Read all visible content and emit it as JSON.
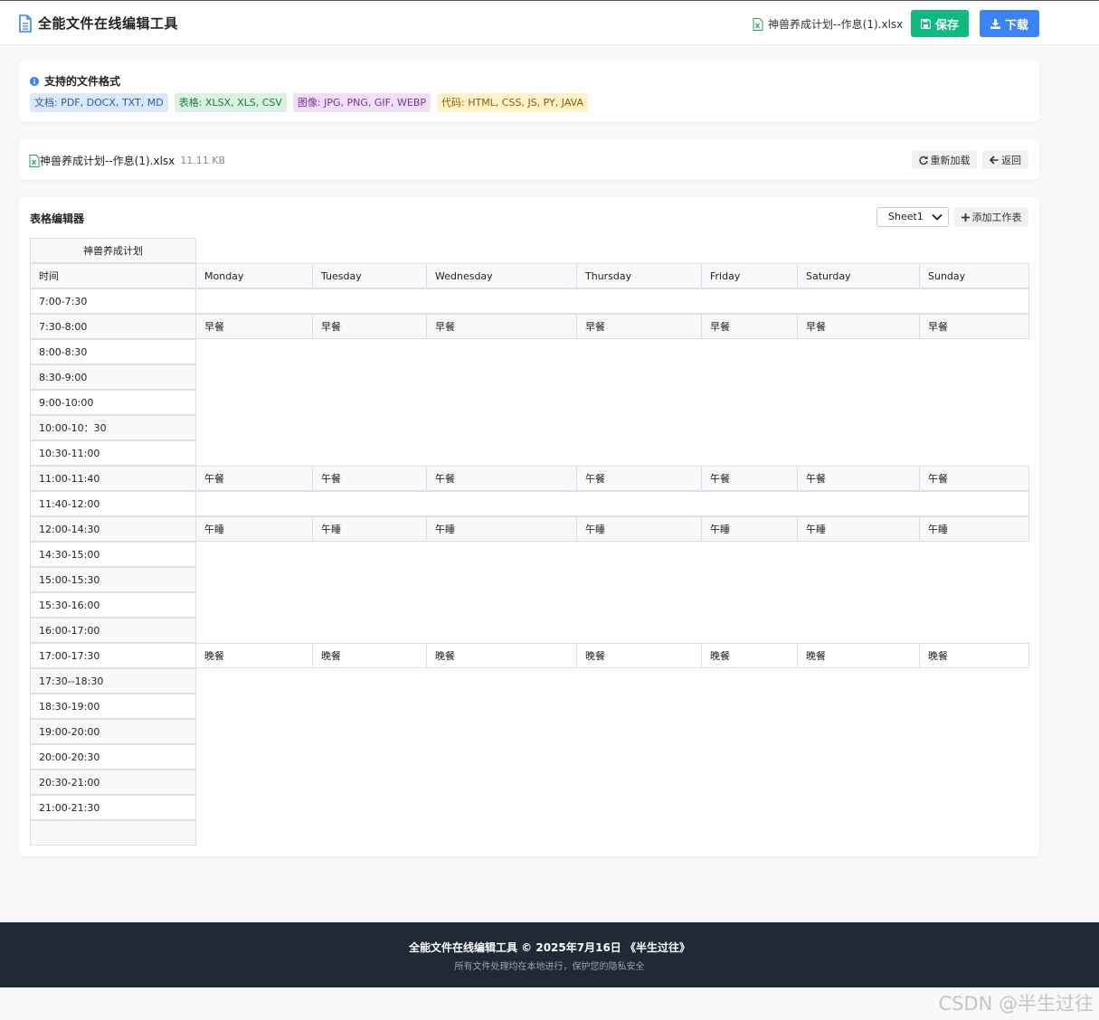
{
  "app": {
    "title": "全能文件在线编辑工具",
    "current_file": "神兽养成计划--作息(1).xlsx",
    "save_label": "保存",
    "download_label": "下载"
  },
  "formats": {
    "heading": "支持的文件格式",
    "tags": [
      {
        "label": "文档: PDF, DOCX, TXT, MD",
        "color": "#dbe8fb"
      },
      {
        "label": "表格: XLSX, XLS, CSV",
        "color": "#daf2e1"
      },
      {
        "label": "图像: JPG, PNG, GIF, WEBP",
        "color": "#efe0f8"
      },
      {
        "label": "代码: HTML, CSS, JS, PY, JAVA",
        "color": "#fdf3c7"
      }
    ]
  },
  "file": {
    "name": "神兽养成计划--作息(1).xlsx",
    "size": "11.11 KB",
    "reload_label": "重新加载",
    "back_label": "返回"
  },
  "editor": {
    "title": "表格编辑器",
    "sheet": "Sheet1",
    "add_sheet_label": "添加工作表",
    "table_title": "神兽养成计划",
    "header": [
      "时间",
      "Monday",
      "Tuesday",
      "Wednesday",
      "Thursday",
      "Friday",
      "Saturday",
      "Sunday"
    ],
    "rows": [
      [
        "7:00-7:30",
        "",
        "",
        "",
        "",
        "",
        "",
        ""
      ],
      [
        "7:30-8:00",
        "早餐",
        "早餐",
        "早餐",
        "早餐",
        "早餐",
        "早餐",
        "早餐"
      ],
      [
        "8:00-8:30",
        "",
        "",
        "",
        "",
        "",
        "",
        ""
      ],
      [
        "8:30-9:00",
        "",
        "",
        "",
        "",
        "",
        "",
        ""
      ],
      [
        "9:00-10:00",
        "",
        "",
        "",
        "",
        "",
        "",
        ""
      ],
      [
        "10:00-10：30",
        "",
        "",
        "",
        "",
        "",
        "",
        ""
      ],
      [
        "10:30-11:00",
        "",
        "",
        "",
        "",
        "",
        "",
        ""
      ],
      [
        "11:00-11:40",
        "午餐",
        "午餐",
        "午餐",
        "午餐",
        "午餐",
        "午餐",
        "午餐"
      ],
      [
        "11:40-12:00",
        "",
        "",
        "",
        "",
        "",
        "",
        ""
      ],
      [
        "12:00-14:30",
        "午睡",
        "午睡",
        "午睡",
        "午睡",
        "午睡",
        "午睡",
        "午睡"
      ],
      [
        "14:30-15:00",
        "",
        "",
        "",
        "",
        "",
        "",
        ""
      ],
      [
        "15:00-15:30",
        "",
        "",
        "",
        "",
        "",
        "",
        ""
      ],
      [
        "15:30-16:00",
        "",
        "",
        "",
        "",
        "",
        "",
        ""
      ],
      [
        "16:00-17:00",
        "",
        "",
        "",
        "",
        "",
        "",
        ""
      ],
      [
        "17:00-17:30",
        "晚餐",
        "晚餐",
        "晚餐",
        "晚餐",
        "晚餐",
        "晚餐",
        "晚餐"
      ],
      [
        "17:30--18:30",
        "",
        "",
        "",
        "",
        "",
        "",
        ""
      ],
      [
        "18:30-19:00",
        "",
        "",
        "",
        "",
        "",
        "",
        ""
      ],
      [
        "19:00-20:00",
        "",
        "",
        "",
        "",
        "",
        "",
        ""
      ],
      [
        "20:00-20:30",
        "",
        "",
        "",
        "",
        "",
        "",
        ""
      ],
      [
        "20:30-21:00",
        "",
        "",
        "",
        "",
        "",
        "",
        ""
      ],
      [
        "21:00-21:30",
        "",
        "",
        "",
        "",
        "",
        "",
        ""
      ],
      [
        "",
        "",
        "",
        "",
        "",
        "",
        "",
        ""
      ]
    ]
  },
  "footer": {
    "line1": "全能文件在线编辑工具 © 2025年7月16日 《半生过往》",
    "line2": "所有文件处理均在本地进行，保护您的隐私安全"
  },
  "watermark": "CSDN @半生过往"
}
